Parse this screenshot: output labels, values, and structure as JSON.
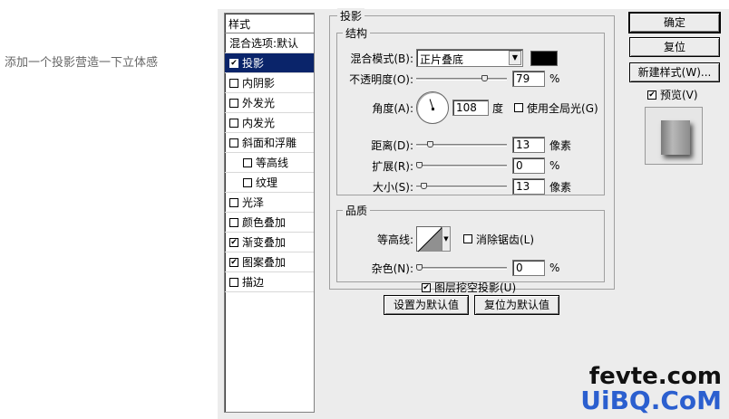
{
  "caption": "添加一个投影营造一下立体感",
  "styles_panel": {
    "header": "样式",
    "blend_options": "混合选项:默认",
    "items": [
      {
        "label": "投影",
        "checked": true,
        "active": true,
        "indent": false
      },
      {
        "label": "内阴影",
        "checked": false,
        "active": false,
        "indent": false
      },
      {
        "label": "外发光",
        "checked": false,
        "active": false,
        "indent": false
      },
      {
        "label": "内发光",
        "checked": false,
        "active": false,
        "indent": false
      },
      {
        "label": "斜面和浮雕",
        "checked": false,
        "active": false,
        "indent": false
      },
      {
        "label": "等高线",
        "checked": false,
        "active": false,
        "indent": true
      },
      {
        "label": "纹理",
        "checked": false,
        "active": false,
        "indent": true
      },
      {
        "label": "光泽",
        "checked": false,
        "active": false,
        "indent": false
      },
      {
        "label": "颜色叠加",
        "checked": false,
        "active": false,
        "indent": false
      },
      {
        "label": "渐变叠加",
        "checked": true,
        "active": false,
        "indent": false
      },
      {
        "label": "图案叠加",
        "checked": true,
        "active": false,
        "indent": false
      },
      {
        "label": "描边",
        "checked": false,
        "active": false,
        "indent": false
      }
    ]
  },
  "drop_shadow": {
    "title": "投影",
    "structure": {
      "title": "结构",
      "blend_mode_label": "混合模式(B):",
      "blend_mode_value": "正片叠底",
      "shadow_color": "#000000",
      "opacity_label": "不透明度(O):",
      "opacity_value": "79",
      "opacity_fraction": 0.79,
      "percent": "%",
      "angle_label": "角度(A):",
      "angle_value": "108",
      "angle_unit": "度",
      "global_light_label": "使用全局光(G)",
      "global_light_checked": false,
      "distance_label": "距离(D):",
      "distance_value": "13",
      "distance_fraction": 0.13,
      "spread_label": "扩展(R):",
      "spread_value": "0",
      "spread_fraction": 0,
      "size_label": "大小(S):",
      "size_value": "13",
      "size_fraction": 0.05,
      "pixel_unit": "像素"
    },
    "quality": {
      "title": "品质",
      "contour_label": "等高线:",
      "anti_alias_label": "消除锯齿(L)",
      "anti_alias_checked": false,
      "noise_label": "杂色(N):",
      "noise_value": "0",
      "noise_fraction": 0,
      "percent": "%"
    },
    "knockout_label": "图层挖空投影(U)",
    "knockout_checked": true,
    "make_default": "设置为默认值",
    "reset_default": "复位为默认值"
  },
  "buttons": {
    "ok": "确定",
    "reset": "复位",
    "new_style": "新建样式(W)...",
    "preview_label": "预览(V)",
    "preview_checked": true
  },
  "watermark": {
    "top": "fevte.com",
    "bottom": "UiBQ.CoM"
  }
}
